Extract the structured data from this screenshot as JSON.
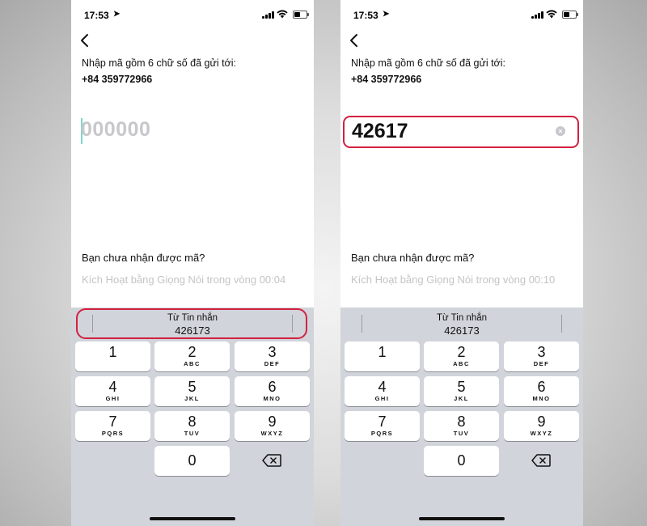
{
  "colors": {
    "highlight": "#d4203f",
    "placeholder": "#c7c7cc",
    "keyboard_bg": "#d1d4da"
  },
  "left": {
    "status": {
      "time": "17:53",
      "location_icon": "➤"
    },
    "back_icon": "‹",
    "prompt": "Nhập mã gồm 6 chữ số đã gửi tới:",
    "phone_number": "+84 359772966",
    "code_placeholder": "000000",
    "not_received": "Bạn chưa nhận được mã?",
    "voice_activation": "Kích Hoạt bằng Giọng Nói trong vòng 00:04",
    "suggestion": {
      "source": "Từ Tin nhắn",
      "code": "426173"
    }
  },
  "right": {
    "status": {
      "time": "17:53",
      "location_icon": "➤"
    },
    "back_icon": "‹",
    "prompt": "Nhập mã gồm 6 chữ số đã gửi tới:",
    "phone_number": "+84 359772966",
    "code_value": "42617",
    "clear_icon": "×",
    "not_received": "Bạn chưa nhận được mã?",
    "voice_activation": "Kích Hoạt bằng Giọng Nói trong vòng 00:10",
    "suggestion": {
      "source": "Từ Tin nhắn",
      "code": "426173"
    }
  },
  "keypad": [
    {
      "num": "1",
      "letters": ""
    },
    {
      "num": "2",
      "letters": "ABC"
    },
    {
      "num": "3",
      "letters": "DEF"
    },
    {
      "num": "4",
      "letters": "GHI"
    },
    {
      "num": "5",
      "letters": "JKL"
    },
    {
      "num": "6",
      "letters": "MNO"
    },
    {
      "num": "7",
      "letters": "PQRS"
    },
    {
      "num": "8",
      "letters": "TUV"
    },
    {
      "num": "9",
      "letters": "WXYZ"
    },
    {
      "num": "0",
      "letters": ""
    }
  ]
}
